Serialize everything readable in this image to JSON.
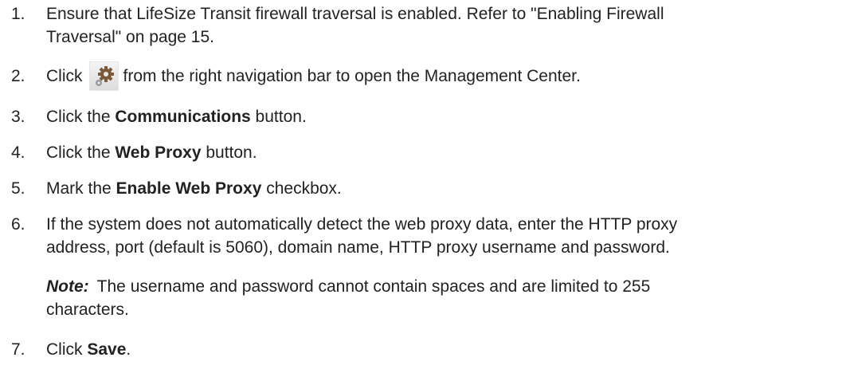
{
  "steps": [
    {
      "num": "1.",
      "line1": "Ensure that LifeSize Transit firewall traversal is enabled. Refer to \"Enabling Firewall",
      "line2": "Traversal\" on page 15."
    },
    {
      "num": "2.",
      "pre": "Click",
      "icon": "settings-gears-icon",
      "post": "from the right navigation bar to open the Management Center."
    },
    {
      "num": "3.",
      "pre": "Click the ",
      "bold": "Communications",
      "post": " button."
    },
    {
      "num": "4.",
      "pre": "Click the ",
      "bold": "Web Proxy",
      "post": " button."
    },
    {
      "num": "5.",
      "pre": "Mark the ",
      "bold": "Enable Web Proxy",
      "post": " checkbox."
    },
    {
      "num": "6.",
      "line1": "If the system does not automatically detect the web proxy data, enter the HTTP proxy",
      "line2": "address, port (default is 5060), domain name, HTTP proxy username and password."
    },
    {
      "num": "7.",
      "pre": "Click ",
      "bold": "Save",
      "post": "."
    }
  ],
  "note": {
    "label": "Note:",
    "line1": "The username and password cannot contain spaces and are limited to 255",
    "line2": "characters."
  }
}
